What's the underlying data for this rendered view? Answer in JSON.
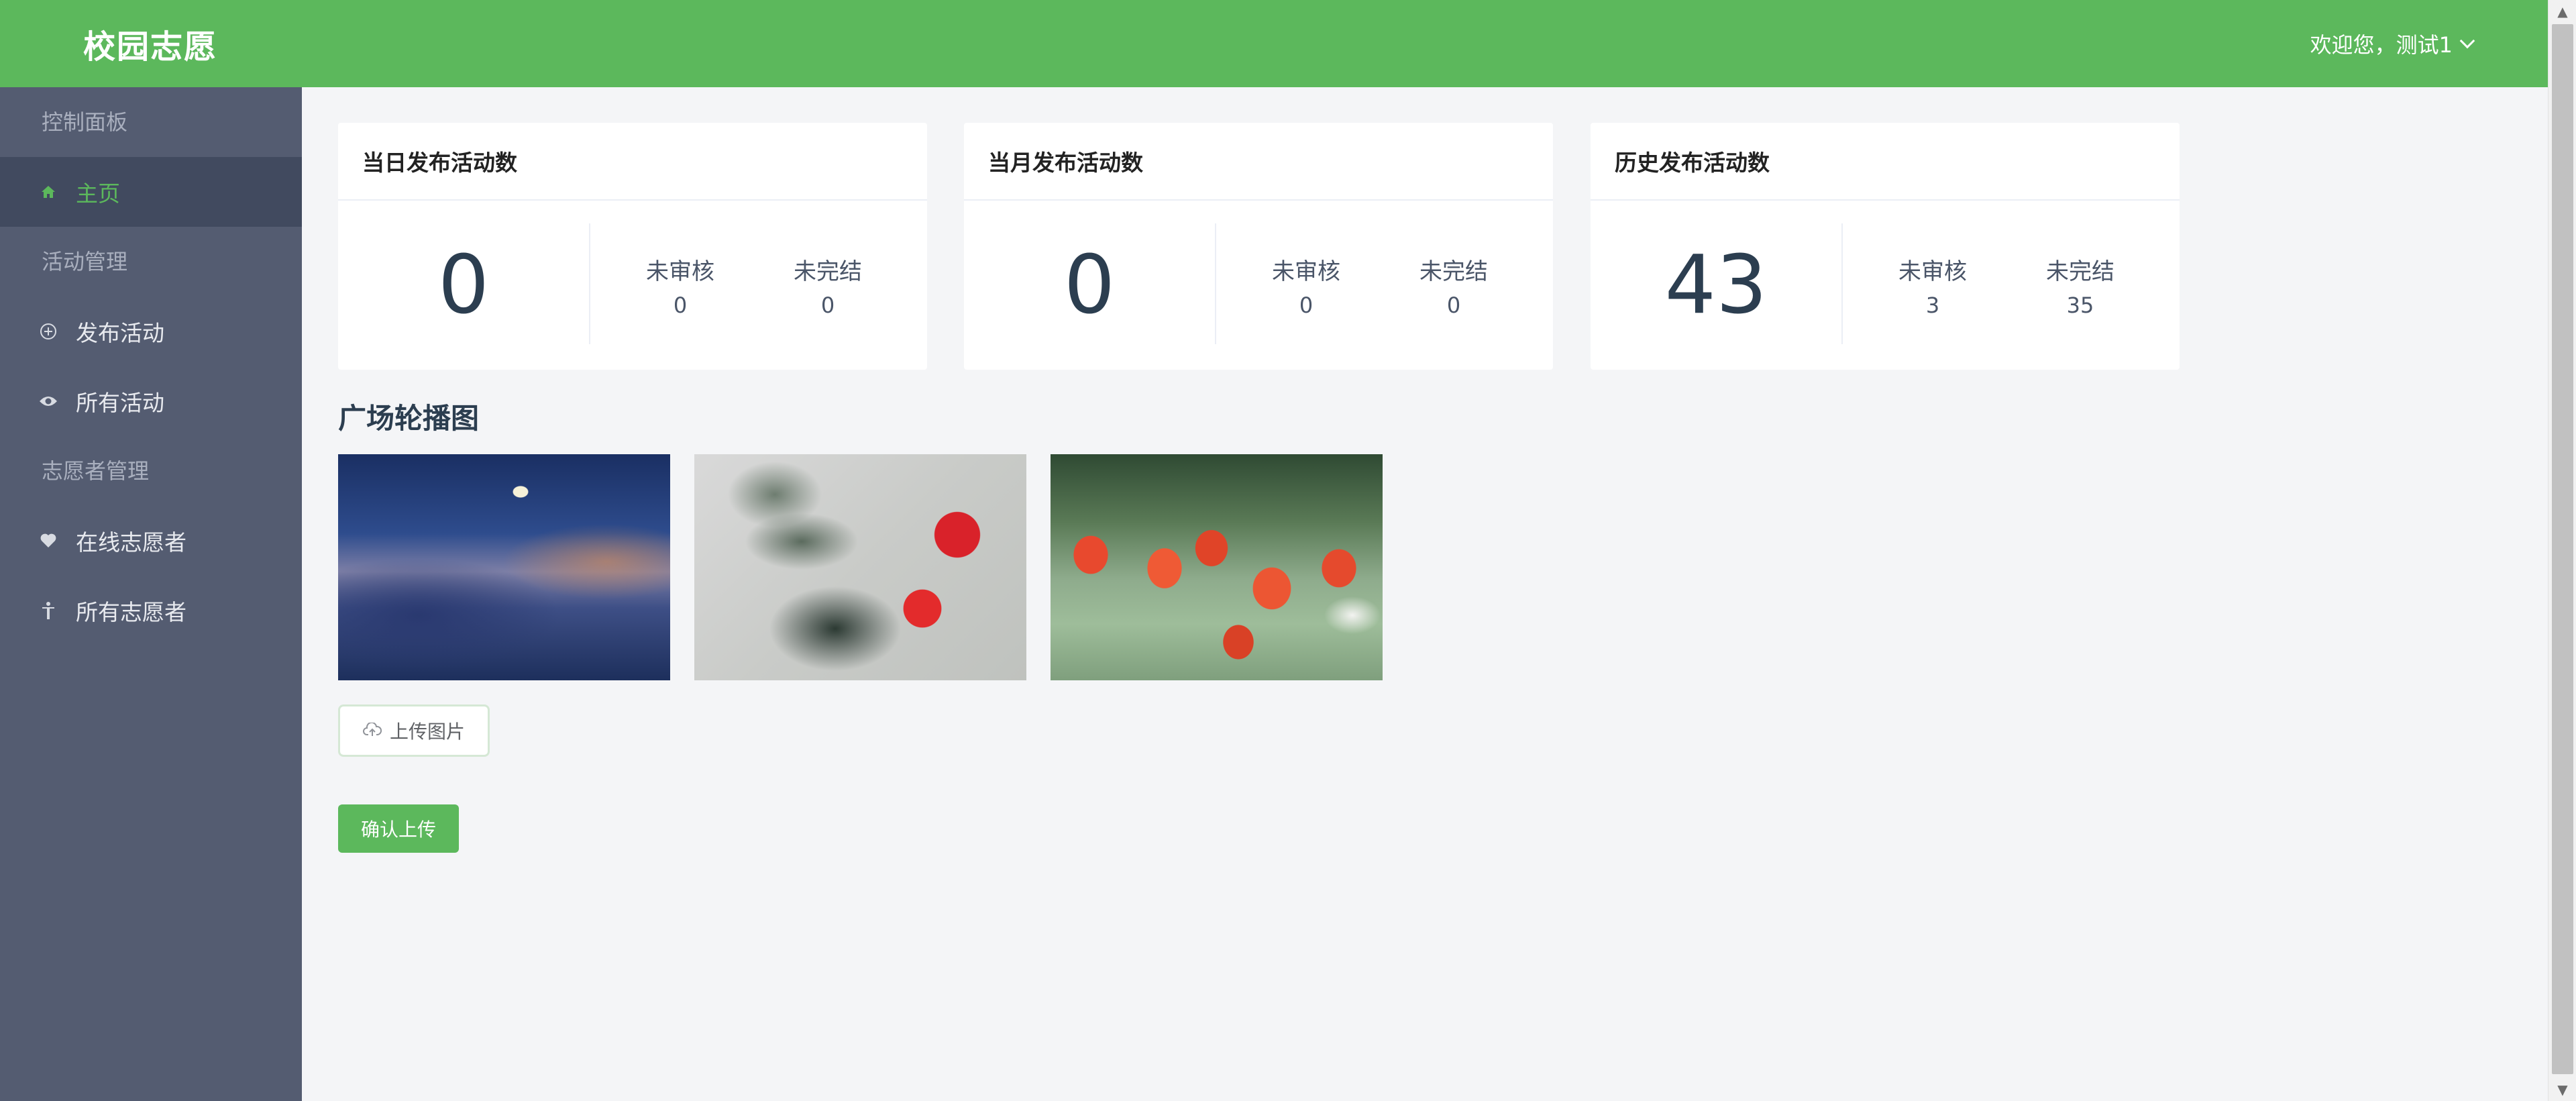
{
  "header": {
    "app_title": "校园志愿",
    "user_greeting": "欢迎您，测试1"
  },
  "sidebar": {
    "groups": [
      {
        "title": "控制面板"
      },
      {
        "title": "活动管理"
      },
      {
        "title": "志愿者管理"
      }
    ],
    "items": [
      {
        "label": "主页",
        "icon": "home-icon",
        "active": true
      },
      {
        "label": "发布活动",
        "icon": "plus-circle-icon",
        "active": false
      },
      {
        "label": "所有活动",
        "icon": "eye-icon",
        "active": false
      },
      {
        "label": "在线志愿者",
        "icon": "heart-icon",
        "active": false
      },
      {
        "label": "所有志愿者",
        "icon": "person-icon",
        "active": false
      }
    ]
  },
  "stats": [
    {
      "title": "当日发布活动数",
      "total": "0",
      "pending_label": "未审核",
      "pending": "0",
      "unfinished_label": "未完结",
      "unfinished": "0"
    },
    {
      "title": "当月发布活动数",
      "total": "0",
      "pending_label": "未审核",
      "pending": "0",
      "unfinished_label": "未完结",
      "unfinished": "0"
    },
    {
      "title": "历史发布活动数",
      "total": "43",
      "pending_label": "未审核",
      "pending": "3",
      "unfinished_label": "未完结",
      "unfinished": "35"
    }
  ],
  "carousel": {
    "title": "广场轮播图",
    "images": [
      "night-sky-clouds-image",
      "red-roses-image",
      "red-tulips-image"
    ],
    "upload_label": "上传图片",
    "confirm_label": "确认上传"
  },
  "colors": {
    "brand": "#5cb85c",
    "sidebar": "#545c71",
    "sidebar_active": "#414a5f"
  }
}
